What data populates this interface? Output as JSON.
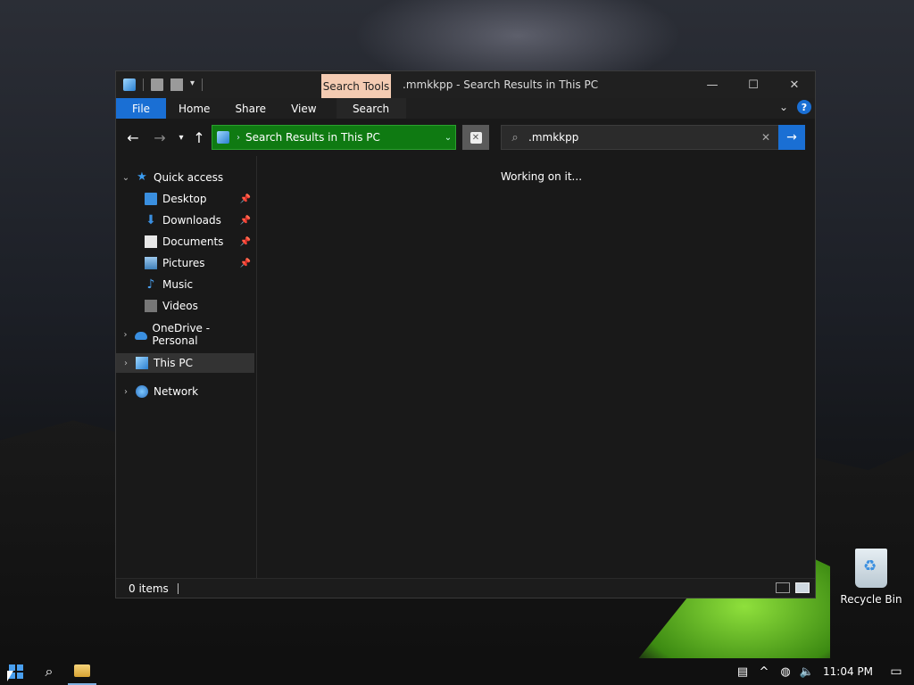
{
  "window": {
    "title": ".mmkkpp - Search Results in This PC",
    "context_tab": "Search Tools"
  },
  "ribbon": {
    "tabs": [
      "File",
      "Home",
      "Share",
      "View",
      "Search"
    ]
  },
  "address": {
    "path": "Search Results in This PC"
  },
  "search": {
    "value": ".mmkkpp"
  },
  "nav": {
    "quick_access": "Quick access",
    "items": [
      "Desktop",
      "Downloads",
      "Documents",
      "Pictures",
      "Music",
      "Videos"
    ],
    "onedrive": "OneDrive - Personal",
    "this_pc": "This PC",
    "network": "Network"
  },
  "content": {
    "status_message": "Working on it..."
  },
  "status": {
    "item_count": "0 items"
  },
  "desktop": {
    "recycle_bin": "Recycle Bin"
  },
  "taskbar": {
    "time": "11:04 PM"
  },
  "colors": {
    "accent": "#1a6fd4",
    "address_bar": "#0f7a12",
    "context_tab": "#f4cbb2"
  }
}
